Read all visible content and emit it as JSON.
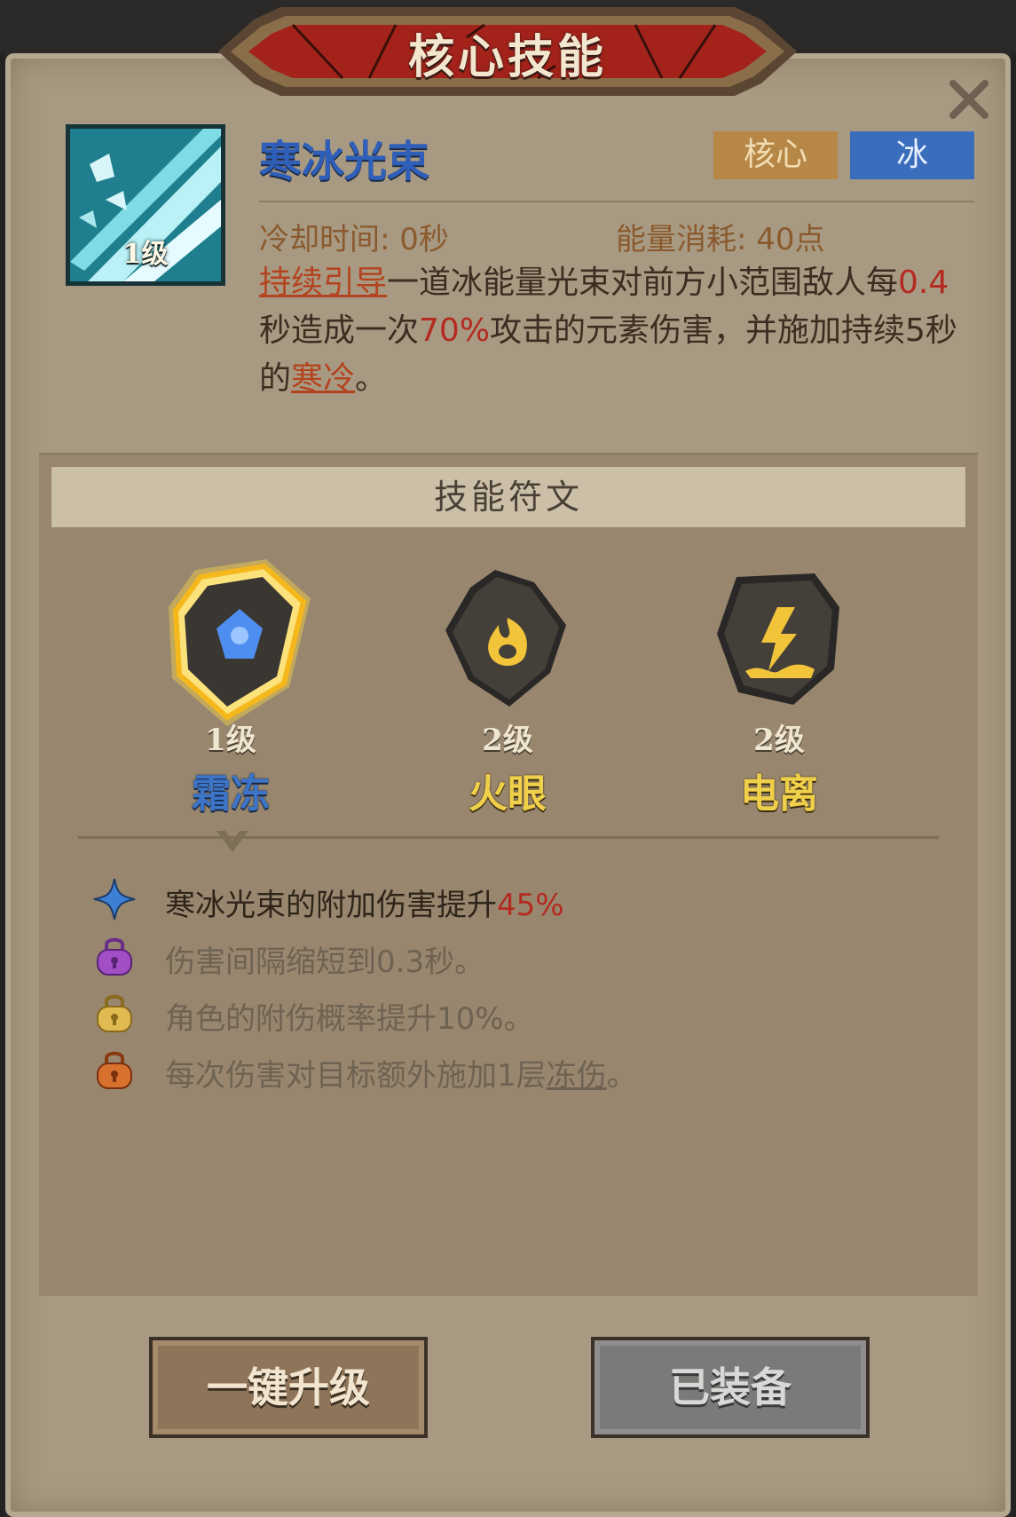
{
  "window": {
    "title": "核心技能"
  },
  "close": {
    "icon": "close-icon"
  },
  "skill": {
    "name": "寒冰光束",
    "level": "1级",
    "tags": {
      "core": "核心",
      "element": "冰"
    },
    "cooldown": "冷却时间: 0秒",
    "energy": "能量消耗: 40点",
    "description": {
      "p1": "持续引导",
      "p2": "一道冰能量光束对前方小范围敌人每",
      "p3": "0.4",
      "p4": "秒造成一次",
      "p5": "70%",
      "p6": "攻击的元素伤害，并施加持续5秒的",
      "p7": "寒冷",
      "p8": "。"
    }
  },
  "runes": {
    "header": "技能符文",
    "items": [
      {
        "level": "1级",
        "name": "霜冻",
        "icon": "snowflake-icon",
        "selected": true
      },
      {
        "level": "2级",
        "name": "火眼",
        "icon": "flame-icon",
        "selected": false
      },
      {
        "level": "2级",
        "name": "电离",
        "icon": "lightning-icon",
        "selected": false
      }
    ]
  },
  "effects": [
    {
      "icon": "diamond-star-icon",
      "text": "寒冰光束的附加伤害提升",
      "highlight": "45%",
      "locked": false
    },
    {
      "icon": "lock-purple-icon",
      "text": "伤害间隔缩短到0.3秒。",
      "locked": true
    },
    {
      "icon": "lock-gold-icon",
      "text": "角色的附伤概率提升10%。",
      "locked": true
    },
    {
      "icon": "lock-orange-icon",
      "text_pre": "每次伤害对目标额外施加1层",
      "text_link": "冻伤",
      "text_post": "。",
      "locked": true
    }
  ],
  "buttons": {
    "upgrade": "一键升级",
    "equipped": "已装备"
  },
  "colors": {
    "panel": "#a89a82",
    "banner": "#a3231b",
    "skill_name": "#2f5fb8",
    "highlight_red": "#b42a20",
    "tag_core": "#b78747",
    "tag_ice": "#3a6dbb"
  }
}
